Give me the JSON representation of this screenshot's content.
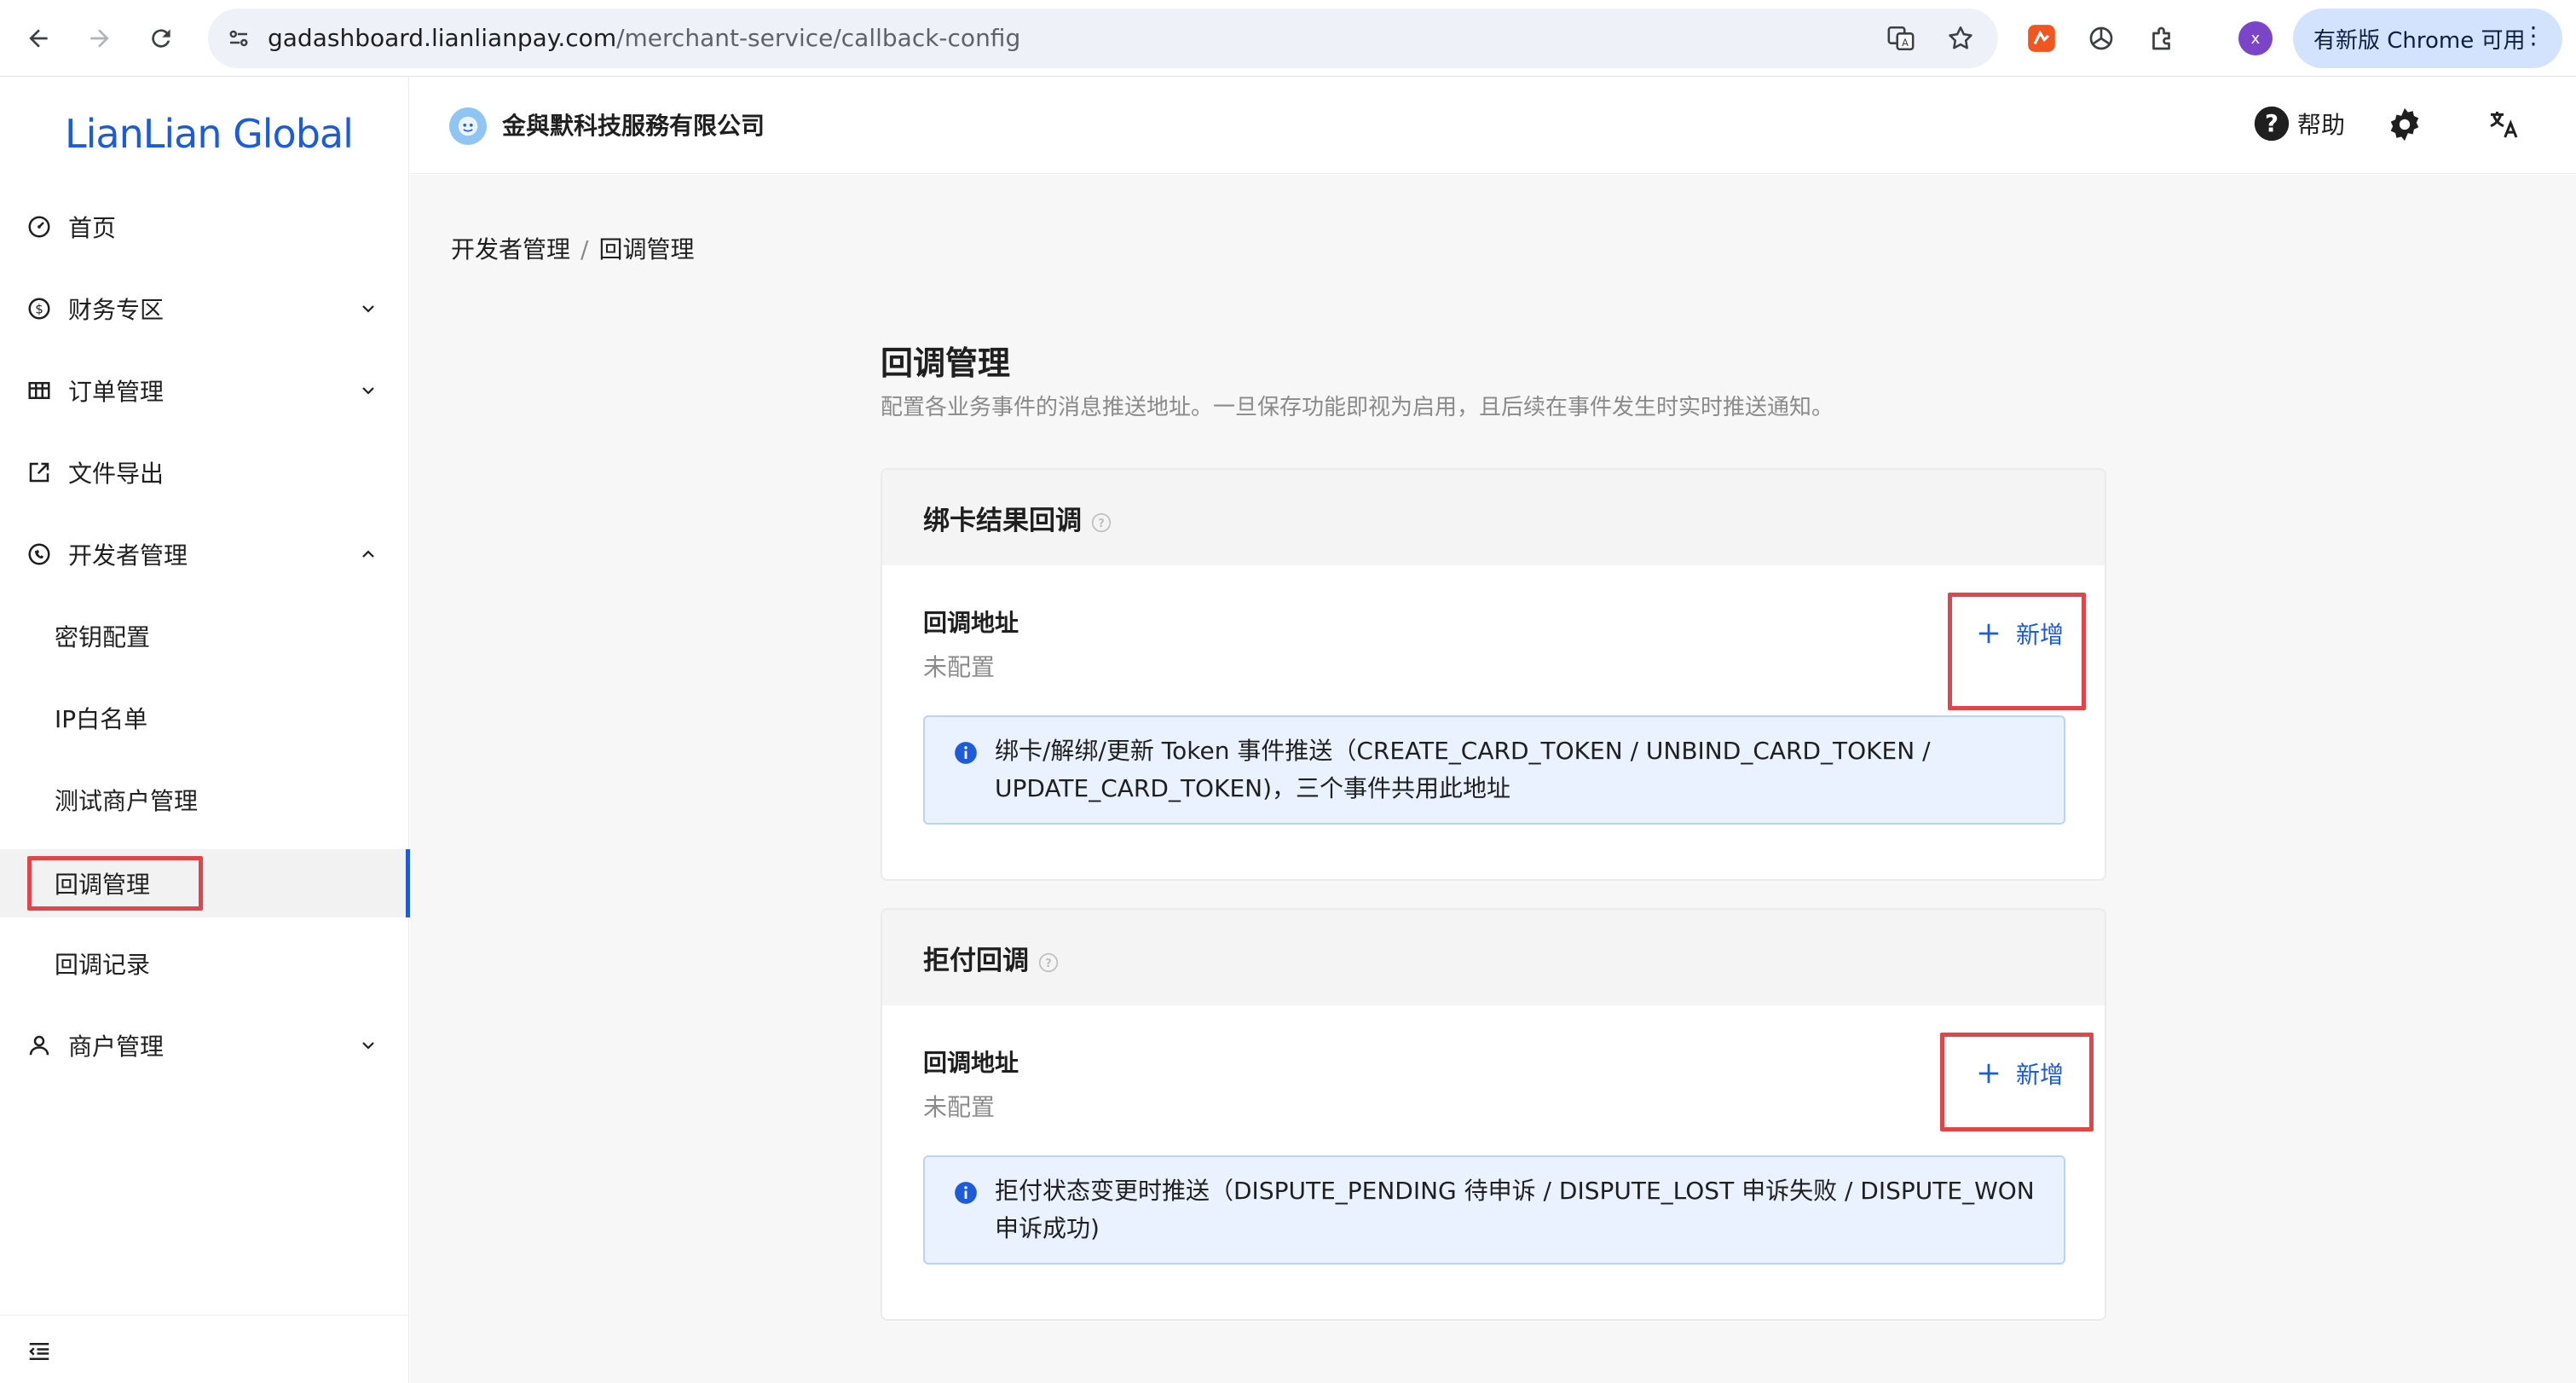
{
  "browser": {
    "url_host": "gadashboard.lianlianpay.com",
    "url_path": "/merchant-service/callback-config",
    "profile_initial": "x",
    "update_chip_label": "有新版 Chrome 可用"
  },
  "sidebar": {
    "brand": "LianLian Global",
    "items": [
      {
        "label": "首页",
        "icon": "dashboard-icon"
      },
      {
        "label": "财务专区",
        "icon": "dollar-circle-icon"
      },
      {
        "label": "订单管理",
        "icon": "table-icon"
      },
      {
        "label": "文件导出",
        "icon": "export-icon"
      },
      {
        "label": "开发者管理",
        "icon": "api-icon"
      },
      {
        "label": "密钥配置"
      },
      {
        "label": "IP白名单"
      },
      {
        "label": "测试商户管理"
      },
      {
        "label": "回调管理"
      },
      {
        "label": "回调记录"
      },
      {
        "label": "商户管理",
        "icon": "user-icon"
      }
    ],
    "active_item": "回调管理"
  },
  "header": {
    "company_name": "金與默科技服務有限公司",
    "help_label": "帮助"
  },
  "breadcrumb": {
    "parent": "开发者管理",
    "separator": "/",
    "current": "回调管理"
  },
  "page": {
    "title": "回调管理",
    "description": "配置各业务事件的消息推送地址。一旦保存功能即视为启用，且后续在事件发生时实时推送通知。"
  },
  "cards": [
    {
      "title": "绑卡结果回调",
      "field_label": "回调地址",
      "field_value": "未配置",
      "add_label": "新增",
      "info_line1": "绑卡/解绑/更新 Token 事件推送（CREATE_CARD_TOKEN / UNBIND_CARD_TOKEN /",
      "info_line2": "UPDATE_CARD_TOKEN)，三个事件共用此地址"
    },
    {
      "title": "拒付回调",
      "field_label": "回调地址",
      "field_value": "未配置",
      "add_label": "新增",
      "info_line1": "拒付状态变更时推送（DISPUTE_PENDING 待申诉 / DISPUTE_LOST 申诉失败 / DISPUTE_WON",
      "info_line2": "申诉成功)"
    }
  ],
  "colors": {
    "brand_blue": "#1d5bd8",
    "highlight_red": "#e0454a",
    "info_bg": "#eaf2ff"
  }
}
